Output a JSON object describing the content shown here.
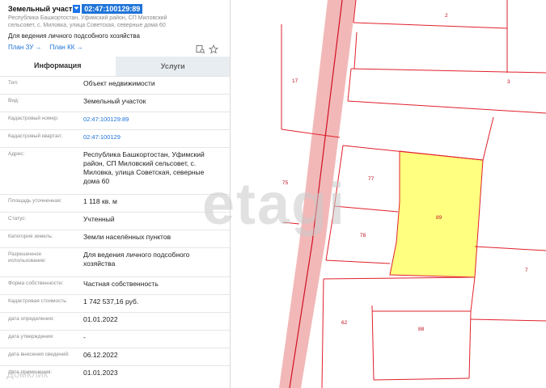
{
  "header": {
    "title": "Земельный участ",
    "cadastral_number": "02:47:100129:89",
    "address_small": "Республика Башкортостан, Уфимский район, СП Миловский сельсовет, с. Миловка, улица Советская, северные дома 60",
    "purpose": "Для ведения личного подсобного хозяйства",
    "plan_zu": "План ЗУ →",
    "plan_kk": "План КК →"
  },
  "tabs": {
    "info": "Информация",
    "services": "Услуги"
  },
  "rows": [
    {
      "key": "Тип:",
      "value": "Объект недвижимости"
    },
    {
      "key": "Вид:",
      "value": "Земельный участок"
    },
    {
      "key": "Кадастровый номер:",
      "value": "02:47:100129:89"
    },
    {
      "key": "Кадастровый квартал:",
      "value": "02:47:100129"
    },
    {
      "key": "Адрес:",
      "value": "Республика Башкортостан, Уфимский район, СП Миловский сельсовет, с. Миловка, улица Советская, северные дома 60"
    },
    {
      "key": "Площадь уточненная:",
      "value": "1 118 кв. м"
    },
    {
      "key": "Статус:",
      "value": "Учтенный"
    },
    {
      "key": "Категория земель:",
      "value": "Земли населённых пунктов"
    },
    {
      "key": "Разрешенное использование:",
      "value": "Для ведения личного подсобного хозяйства"
    },
    {
      "key": "Форма собственности:",
      "value": "Частная собственность"
    },
    {
      "key": "Кадастровая стоимость:",
      "value": "1 742 537,16 руб."
    },
    {
      "key": "дата определения:",
      "value": "01.01.2022"
    },
    {
      "key": "дата утверждения:",
      "value": "-"
    },
    {
      "key": "дата внесения сведений:",
      "value": "06.12.2022"
    },
    {
      "key": "дата применения:",
      "value": "01.01.2023"
    }
  ],
  "map": {
    "parcel_labels": [
      "2",
      "17",
      "3",
      "77",
      "89",
      "75",
      "78",
      "7",
      "62",
      "88"
    ],
    "highlight_color": "#ffff80",
    "boundary_color": "#e0202a"
  },
  "watermark": {
    "brand": "etagi",
    "partner": "Домклик"
  }
}
